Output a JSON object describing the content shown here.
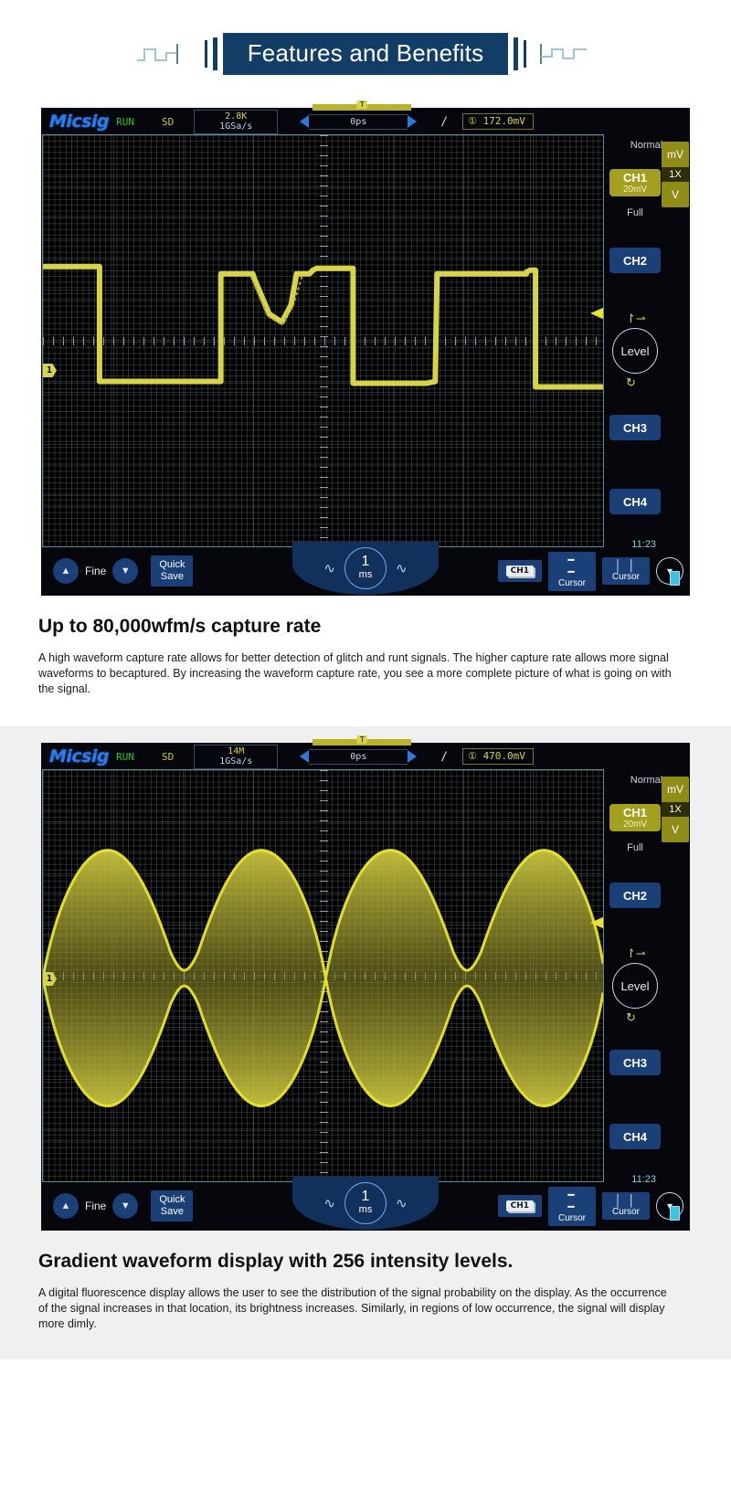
{
  "banner": {
    "title": "Features and Benefits"
  },
  "sections": [
    {
      "scope": {
        "brand": "Micsig",
        "run_status": "RUN",
        "storage": "SD",
        "memory_depth": "2.8K",
        "sample_rate": "1GSa/s",
        "trigger_position": "0ps",
        "trigger_flag": "T",
        "trigger_slope_icon": "rising-edge-icon",
        "trigger_source": "①",
        "trigger_level": "172.0mV",
        "trigger_mode": "Normal",
        "ch1_label": "CH1",
        "ch1_scale": "20mV",
        "ch1_bandwidth": "Full",
        "unit_top": "mV",
        "probe_ratio": "1X",
        "unit_bottom": "V",
        "channels": [
          "CH2",
          "CH3",
          "CH4"
        ],
        "level_knob": "Level",
        "ch_marker": "1",
        "bottom": {
          "fine": "Fine",
          "quick_save_line1": "Quick",
          "quick_save_line2": "Save",
          "timebase_value": "1",
          "timebase_unit": "ms",
          "channel_chip": "CH1",
          "cursor_h": "Cursor",
          "cursor_v": "Cursor",
          "clock": "11:23"
        }
      },
      "heading": "Up to 80,000wfm/s capture rate",
      "paragraph": "A high waveform capture rate allows for better detection of glitch and runt signals.  The higher capture rate allows more signal waveforms to becaptured. By increasing the waveform capture rate, you see a more complete picture of what is going on with the signal."
    },
    {
      "scope": {
        "brand": "Micsig",
        "run_status": "RUN",
        "storage": "SD",
        "memory_depth": "14M",
        "sample_rate": "1GSa/s",
        "trigger_position": "0ps",
        "trigger_flag": "T",
        "trigger_slope_icon": "rising-edge-icon",
        "trigger_source": "①",
        "trigger_level": "470.0mV",
        "trigger_mode": "Normal",
        "ch1_label": "CH1",
        "ch1_scale": "20mV",
        "ch1_bandwidth": "Full",
        "unit_top": "mV",
        "probe_ratio": "1X",
        "unit_bottom": "V",
        "channels": [
          "CH2",
          "CH3",
          "CH4"
        ],
        "level_knob": "Level",
        "ch_marker": "1",
        "bottom": {
          "fine": "Fine",
          "quick_save_line1": "Quick",
          "quick_save_line2": "Save",
          "timebase_value": "1",
          "timebase_unit": "ms",
          "channel_chip": "CH1",
          "cursor_h": "Cursor",
          "cursor_v": "Cursor",
          "clock": "11:23"
        }
      },
      "heading": "Gradient waveform display with 256 intensity levels.",
      "paragraph": "A digital fluorescence display allows the user to see the distribution of the signal probability on the display.  As the occurrence of the signal increases in that location, its brightness increases.  Similarly, in regions of low occurrence, the signal will display more dimly."
    }
  ],
  "colors": {
    "brand_blue": "#2b7de9",
    "banner_navy": "#123e66",
    "waveform_yellow": "#d8d44a",
    "button_blue": "#1b3f77",
    "ch1_olive": "#a3a01f",
    "run_green": "#25c425"
  }
}
